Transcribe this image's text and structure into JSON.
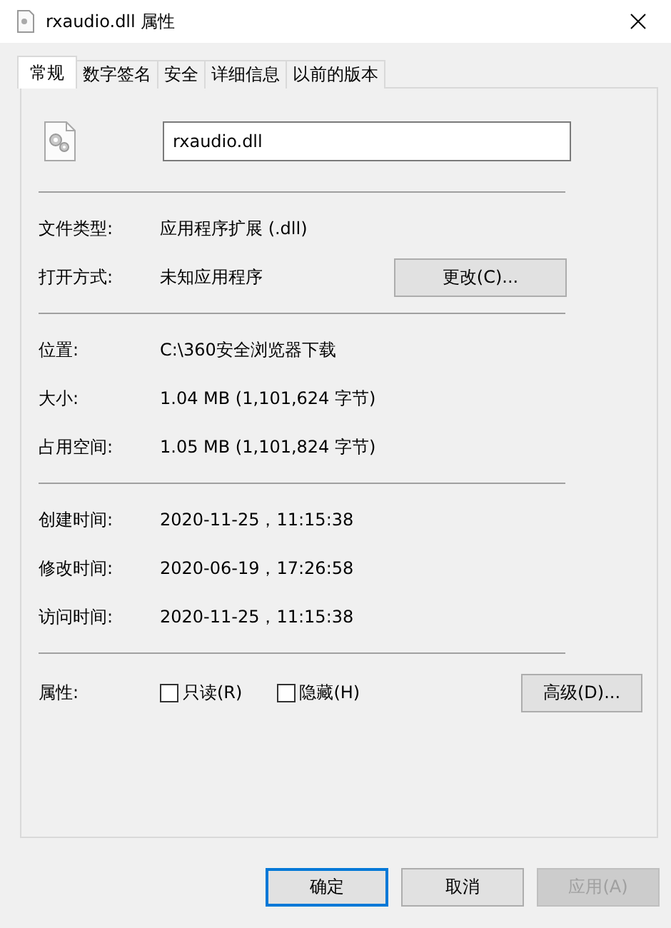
{
  "window": {
    "title": "rxaudio.dll 属性"
  },
  "tabs": [
    {
      "label": "常规",
      "selected": true
    },
    {
      "label": "数字签名",
      "selected": false
    },
    {
      "label": "安全",
      "selected": false
    },
    {
      "label": "详细信息",
      "selected": false
    },
    {
      "label": "以前的版本",
      "selected": false
    }
  ],
  "file_name": "rxaudio.dll",
  "sections": [
    {
      "rows": [
        {
          "label": "文件类型:",
          "value": "应用程序扩展 (.dll)"
        },
        {
          "label": "打开方式:",
          "value": "未知应用程序",
          "button": "更改(C)..."
        }
      ]
    },
    {
      "rows": [
        {
          "label": "位置:",
          "value": "C:\\360安全浏览器下载"
        },
        {
          "label": "大小:",
          "value": "1.04 MB (1,101,624 字节)"
        },
        {
          "label": "占用空间:",
          "value": "1.05 MB (1,101,824 字节)"
        }
      ]
    },
    {
      "rows": [
        {
          "label": "创建时间:",
          "value": "2020-11-25，11:15:38"
        },
        {
          "label": "修改时间:",
          "value": "2020-06-19，17:26:58"
        },
        {
          "label": "访问时间:",
          "value": "2020-11-25，11:15:38"
        }
      ]
    }
  ],
  "attributes": {
    "label": "属性:",
    "checkboxes": [
      {
        "label": "只读(R)",
        "checked": false
      },
      {
        "label": "隐藏(H)",
        "checked": false
      }
    ],
    "button": "高级(D)..."
  },
  "buttons": [
    {
      "label": "确定",
      "default": true,
      "disabled": false
    },
    {
      "label": "取消",
      "default": false,
      "disabled": false
    },
    {
      "label": "应用(A)",
      "default": false,
      "disabled": true
    }
  ]
}
